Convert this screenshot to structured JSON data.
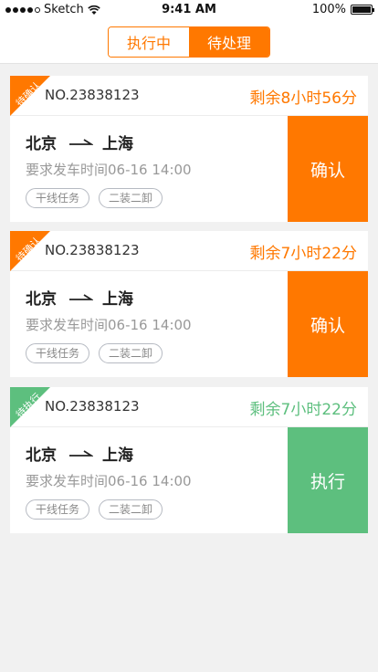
{
  "status_bar": {
    "carrier": "Sketch",
    "time": "9:41 AM",
    "battery": "100%"
  },
  "tabs": {
    "executing": "执行中",
    "pending": "待处理"
  },
  "orders": [
    {
      "badge": "待确认",
      "number": "NO.23838123",
      "remaining": "剩余8小时56分",
      "from": "北京",
      "to": "上海",
      "depart": "要求发车时间06-16 14:00",
      "tags": [
        "干线任务",
        "二装二卸"
      ],
      "action": "确认",
      "status_color": "#ff7800"
    },
    {
      "badge": "待确认",
      "number": "NO.23838123",
      "remaining": "剩余7小时22分",
      "from": "北京",
      "to": "上海",
      "depart": "要求发车时间06-16 14:00",
      "tags": [
        "干线任务",
        "二装二卸"
      ],
      "action": "确认",
      "status_color": "#ff7800"
    },
    {
      "badge": "待执行",
      "number": "NO.23838123",
      "remaining": "剩余7小时22分",
      "from": "北京",
      "to": "上海",
      "depart": "要求发车时间06-16 14:00",
      "tags": [
        "干线任务",
        "二装二卸"
      ],
      "action": "执行",
      "status_color": "#5dbf7e"
    }
  ]
}
